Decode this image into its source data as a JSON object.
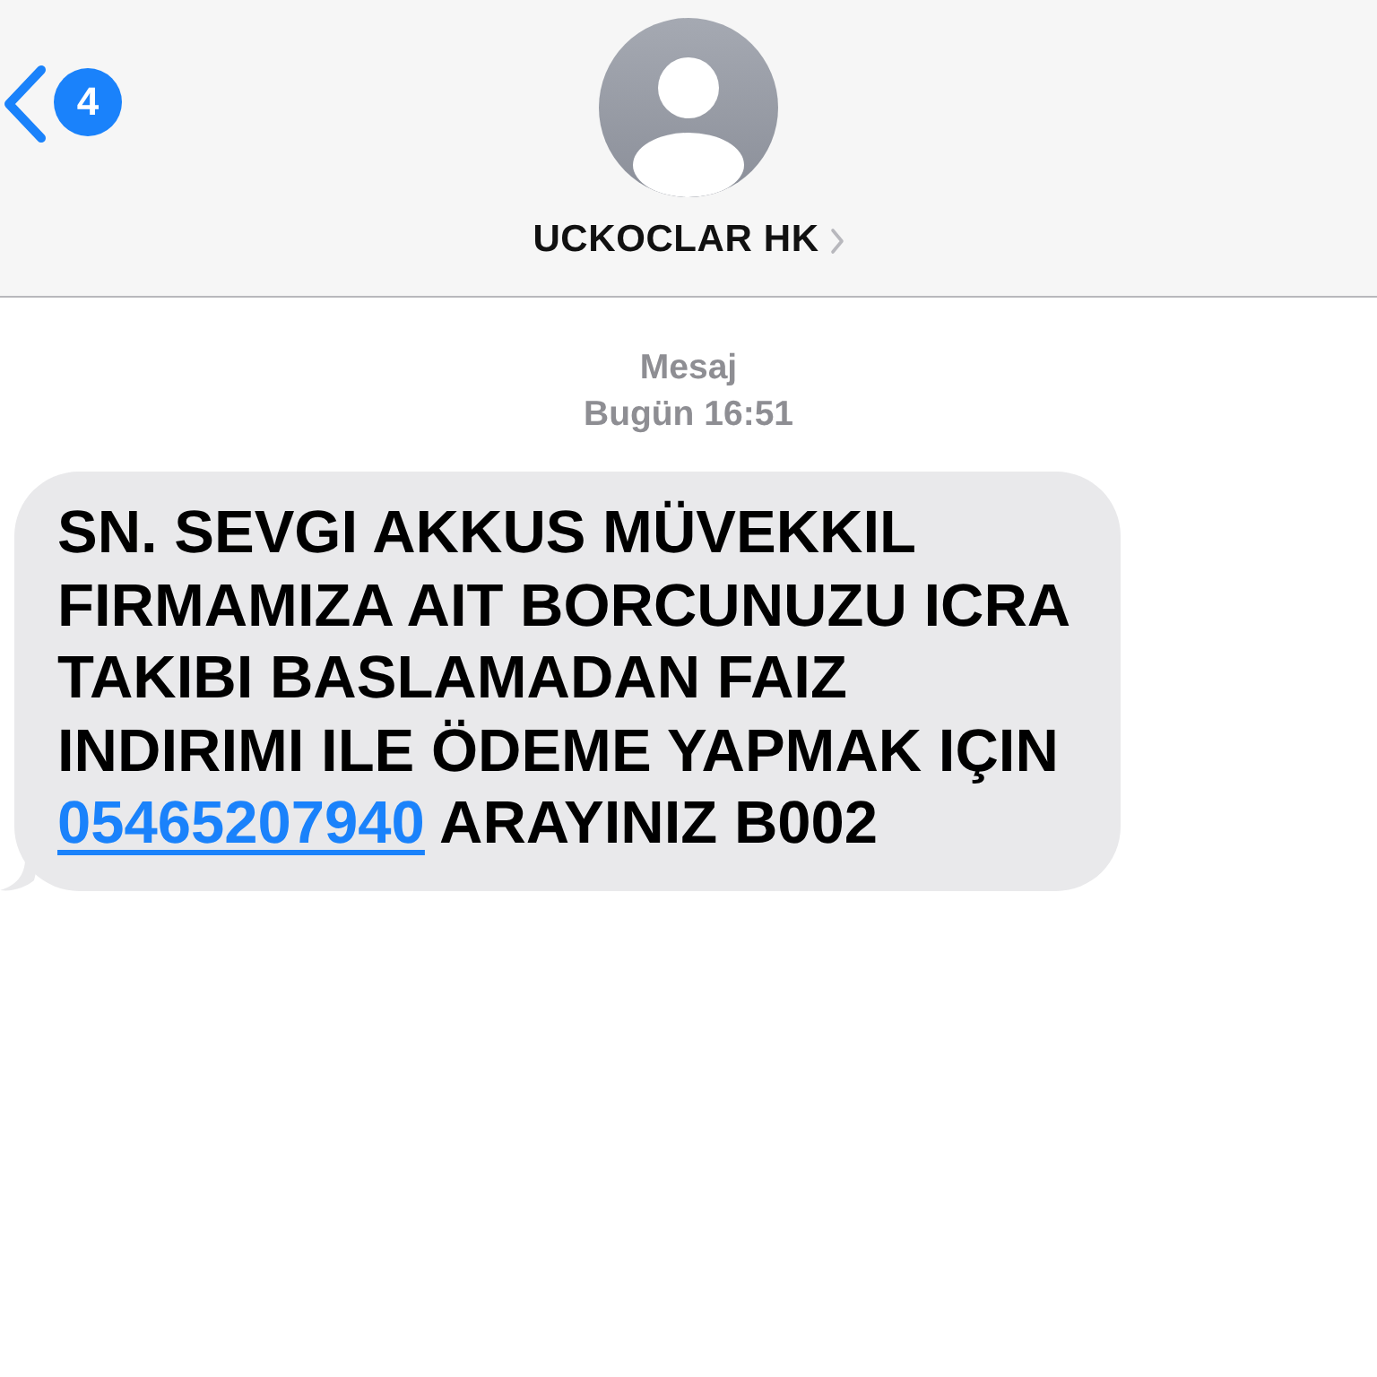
{
  "header": {
    "back": {
      "unread_count": "4"
    },
    "contact": {
      "name": "UCKOCLAR HK"
    }
  },
  "thread": {
    "service": "Mesaj",
    "timestamp": "Bugün 16:51",
    "messages": [
      {
        "incoming": true,
        "parts": [
          {
            "kind": "text",
            "text": "SN. SEVGI AKKUS MÜVEKKIL\nFIRMAMIZA AIT BORCUNUZU ICRA\nTAKIBI BASLAMADAN FAIZ\nINDIRIMI ILE ÖDEME YAPMAK IÇIN\n"
          },
          {
            "kind": "link",
            "text": "05465207940"
          },
          {
            "kind": "text",
            "text": "ARAYINIZ B002"
          }
        ]
      }
    ]
  }
}
